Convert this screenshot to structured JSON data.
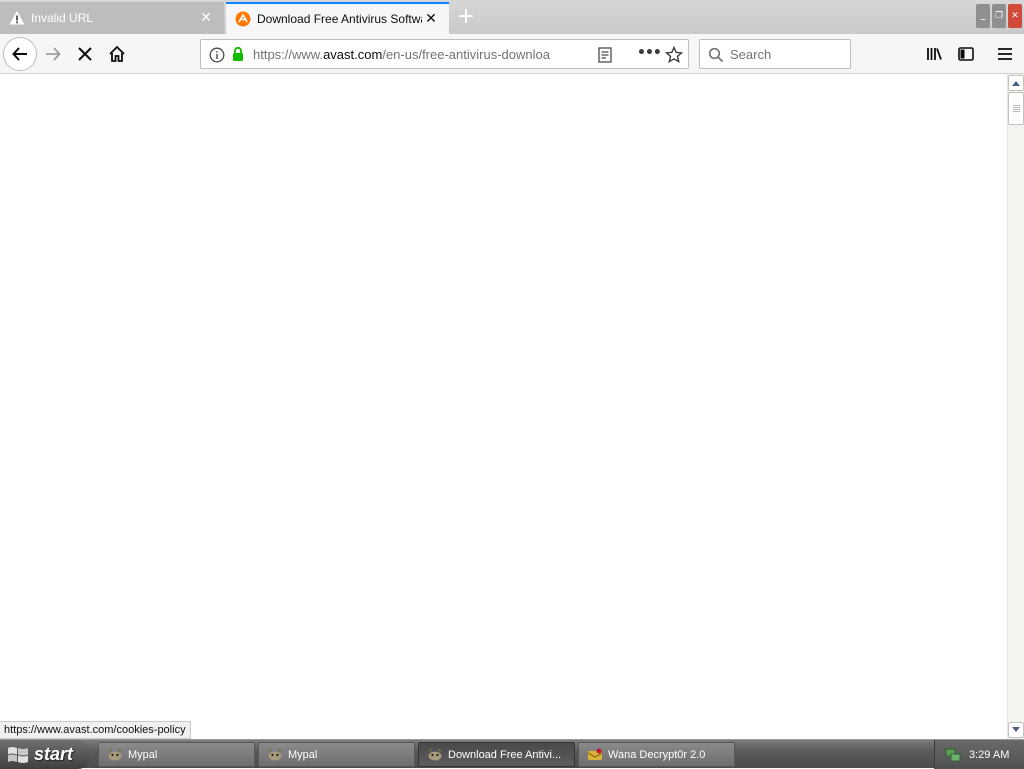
{
  "browser": {
    "tabs": [
      {
        "label": "Invalid URL",
        "icon": "warning-icon",
        "active": false
      },
      {
        "label": "Download Free Antivirus Software",
        "icon": "avast-icon",
        "active": true
      }
    ],
    "url": {
      "prefix": "https://www.",
      "host": "avast.com",
      "path": "/en-us/free-antivirus-downloa"
    },
    "search": {
      "placeholder": "Search"
    },
    "status_text": "https://www.avast.com/cookies-policy"
  },
  "taskbar": {
    "start_label": "start",
    "tasks": [
      {
        "label": "Mypal",
        "icon": "mypal-icon",
        "active": false
      },
      {
        "label": "Mypal",
        "icon": "mypal-icon",
        "active": false
      },
      {
        "label": "Download Free Antivi...",
        "icon": "mypal-icon",
        "active": true
      },
      {
        "label": "Wana Decrypt0r 2.0",
        "icon": "wannacry-icon",
        "active": false
      }
    ],
    "clock": "3:29 AM"
  },
  "colors": {
    "accent": "#0a84ff",
    "lock_green": "#12bc00",
    "avast_orange": "#ff7800",
    "close_red": "#d04a3a"
  }
}
